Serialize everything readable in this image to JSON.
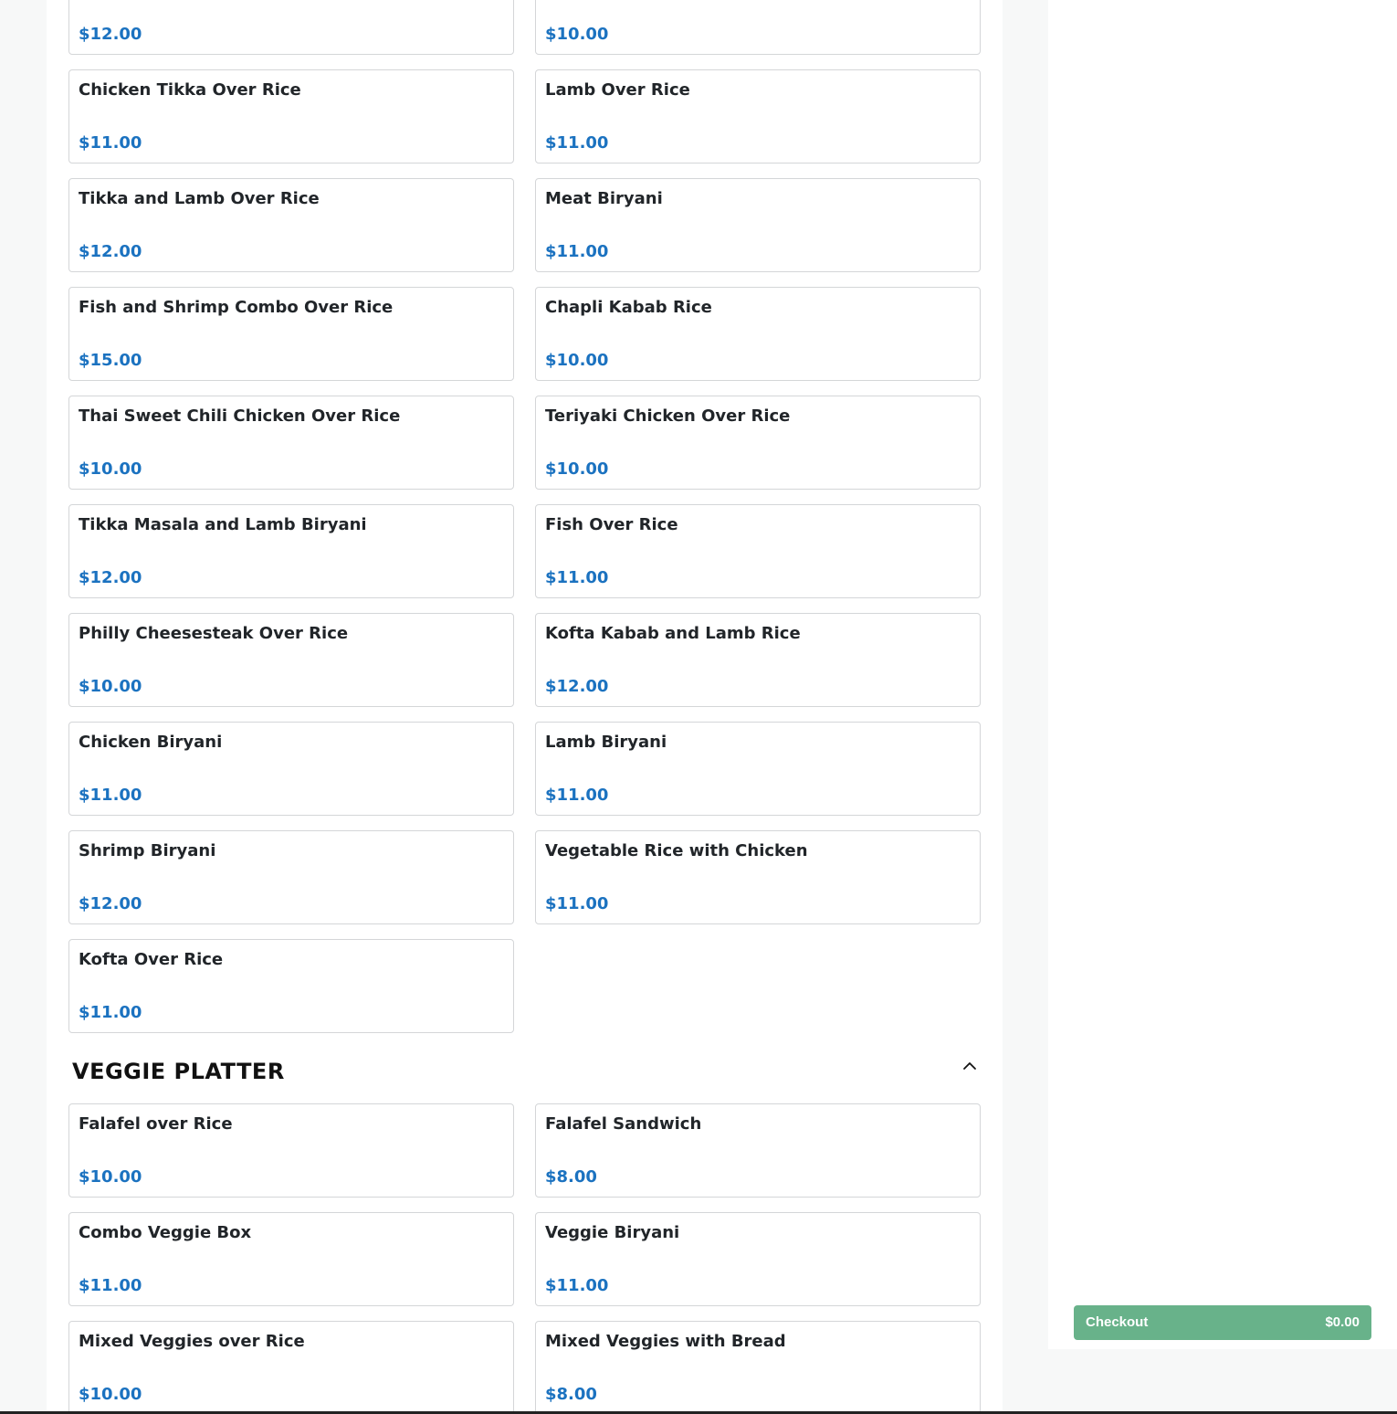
{
  "menu": {
    "items_top": [
      {
        "name": "",
        "price": "$12.00"
      },
      {
        "name": "",
        "price": "$10.00"
      },
      {
        "name": "Chicken Tikka Over Rice",
        "price": "$11.00"
      },
      {
        "name": "Lamb Over Rice",
        "price": "$11.00"
      },
      {
        "name": "Tikka and Lamb Over Rice",
        "price": "$12.00"
      },
      {
        "name": "Meat Biryani",
        "price": "$11.00"
      },
      {
        "name": "Fish and Shrimp Combo Over Rice",
        "price": "$15.00"
      },
      {
        "name": "Chapli Kabab Rice",
        "price": "$10.00"
      },
      {
        "name": "Thai Sweet Chili Chicken Over Rice",
        "price": "$10.00"
      },
      {
        "name": "Teriyaki Chicken Over Rice",
        "price": "$10.00"
      },
      {
        "name": "Tikka Masala and Lamb Biryani",
        "price": "$12.00"
      },
      {
        "name": "Fish Over Rice",
        "price": "$11.00"
      },
      {
        "name": "Philly Cheesesteak Over Rice",
        "price": "$10.00"
      },
      {
        "name": "Kofta Kabab and Lamb Rice",
        "price": "$12.00"
      },
      {
        "name": "Chicken Biryani",
        "price": "$11.00"
      },
      {
        "name": "Lamb Biryani",
        "price": "$11.00"
      },
      {
        "name": "Shrimp Biryani",
        "price": "$12.00"
      },
      {
        "name": "Vegetable Rice with Chicken",
        "price": "$11.00"
      },
      {
        "name": "Kofta Over Rice",
        "price": "$11.00"
      }
    ],
    "veggie_section": {
      "title": "VEGGIE PLATTER",
      "toggle_icon": "chevron-up-icon",
      "items": [
        {
          "name": "Falafel over Rice",
          "price": "$10.00"
        },
        {
          "name": "Falafel Sandwich",
          "price": "$8.00"
        },
        {
          "name": "Combo Veggie Box",
          "price": "$11.00"
        },
        {
          "name": "Veggie Biryani",
          "price": "$11.00"
        },
        {
          "name": "Mixed Veggies over Rice",
          "price": "$10.00"
        },
        {
          "name": "Mixed Veggies with Bread",
          "price": "$8.00"
        }
      ]
    }
  },
  "checkout": {
    "label": "Checkout",
    "total": "$0.00"
  },
  "colors": {
    "price": "#1b72c0",
    "checkout": "#68b28a",
    "card_border": "#d4d6d8",
    "page_background": "#f7f8f8"
  }
}
